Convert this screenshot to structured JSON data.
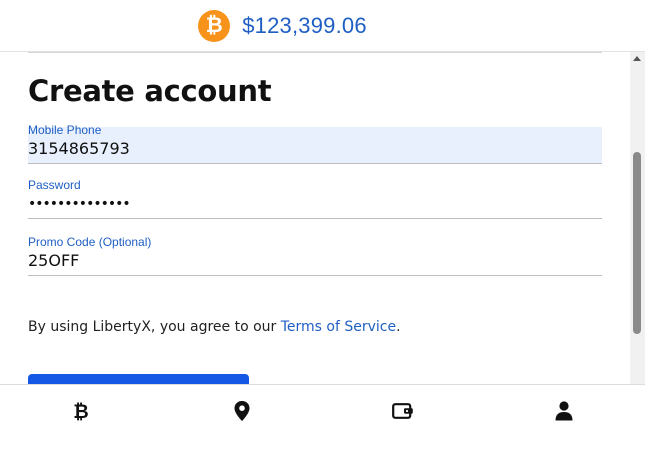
{
  "header": {
    "coin_icon": "bitcoin-icon",
    "coin_symbol": "₿",
    "price": "$123,399.06",
    "accent_color": "#1f5fc4",
    "coin_color": "#f7931a"
  },
  "form": {
    "title": "Create account",
    "fields": [
      {
        "label": "Mobile Phone",
        "value": "3154865793"
      },
      {
        "label": "Password",
        "value": "••••••••••••••"
      },
      {
        "label": "Promo Code (Optional)",
        "value": "25OFF"
      }
    ],
    "terms_prefix": "By using LibertyX, you agree to our ",
    "terms_link": "Terms of Service",
    "terms_suffix": ".",
    "button_color": "#1658e6"
  },
  "bottom_nav": {
    "items": [
      {
        "icon": "bitcoin-icon"
      },
      {
        "icon": "map-pin-icon"
      },
      {
        "icon": "wallet-icon"
      },
      {
        "icon": "user-icon"
      }
    ]
  }
}
